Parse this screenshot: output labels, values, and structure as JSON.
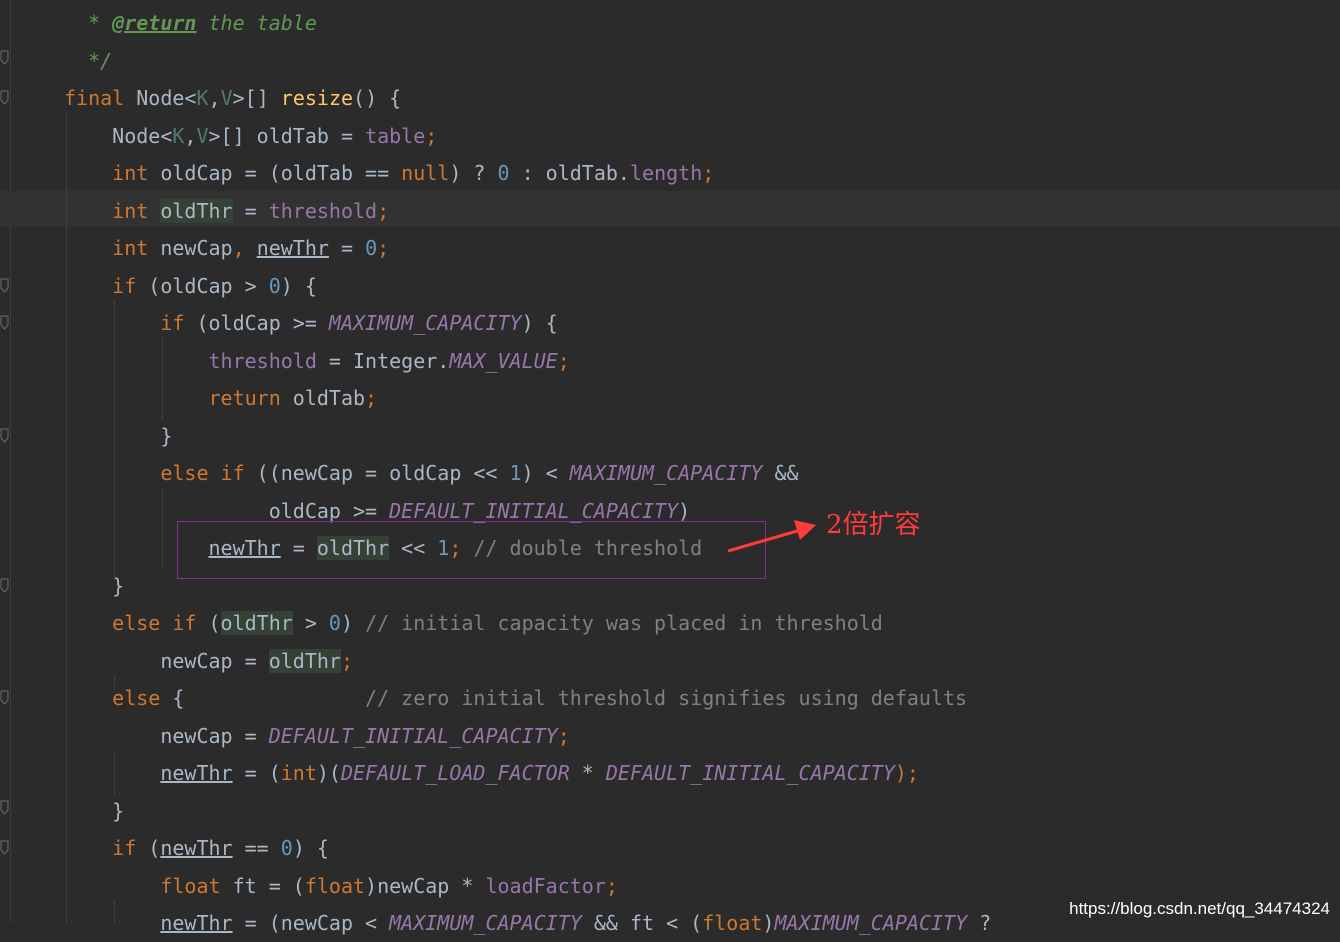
{
  "editor": {
    "lines": [
      [
        {
          "t": "  * ",
          "c": "doc"
        },
        {
          "t": "@return",
          "c": "doctag"
        },
        {
          "t": " the table",
          "c": "doc"
        }
      ],
      [
        {
          "t": "  */",
          "c": "doc"
        }
      ],
      [
        {
          "t": "final ",
          "c": "kw"
        },
        {
          "t": "Node",
          "c": ""
        },
        {
          "t": "<",
          "c": ""
        },
        {
          "t": "K",
          "c": "gen"
        },
        {
          "t": ",",
          "c": ""
        },
        {
          "t": "V",
          "c": "gen"
        },
        {
          "t": ">[] ",
          "c": ""
        },
        {
          "t": "resize",
          "c": "fn"
        },
        {
          "t": "() {",
          "c": ""
        }
      ],
      [
        {
          "t": "    Node",
          "c": ""
        },
        {
          "t": "<",
          "c": ""
        },
        {
          "t": "K",
          "c": "gen"
        },
        {
          "t": ",",
          "c": ""
        },
        {
          "t": "V",
          "c": "gen"
        },
        {
          "t": ">[] oldTab = ",
          "c": ""
        },
        {
          "t": "table",
          "c": "fld"
        },
        {
          "t": ";",
          "c": "kw"
        }
      ],
      [
        {
          "t": "    ",
          "c": ""
        },
        {
          "t": "int ",
          "c": "kw"
        },
        {
          "t": "oldCap = (oldTab == ",
          "c": ""
        },
        {
          "t": "null",
          "c": "kw"
        },
        {
          "t": ") ? ",
          "c": ""
        },
        {
          "t": "0",
          "c": "num"
        },
        {
          "t": " : oldTab.",
          "c": ""
        },
        {
          "t": "length",
          "c": "fld"
        },
        {
          "t": ";",
          "c": "kw"
        }
      ],
      [
        {
          "t": "    ",
          "c": ""
        },
        {
          "t": "int ",
          "c": "kw"
        },
        {
          "t": "oldThr",
          "c": "hl"
        },
        {
          "t": " = ",
          "c": ""
        },
        {
          "t": "threshold",
          "c": "fld"
        },
        {
          "t": ";",
          "c": "kw"
        }
      ],
      [
        {
          "t": "    ",
          "c": ""
        },
        {
          "t": "int ",
          "c": "kw"
        },
        {
          "t": "newCap",
          "c": ""
        },
        {
          "t": ", ",
          "c": "kw"
        },
        {
          "t": "newThr",
          "c": "ul"
        },
        {
          "t": " = ",
          "c": ""
        },
        {
          "t": "0",
          "c": "num"
        },
        {
          "t": ";",
          "c": "kw"
        }
      ],
      [
        {
          "t": "    ",
          "c": ""
        },
        {
          "t": "if ",
          "c": "kw"
        },
        {
          "t": "(oldCap > ",
          "c": ""
        },
        {
          "t": "0",
          "c": "num"
        },
        {
          "t": ") {",
          "c": ""
        }
      ],
      [
        {
          "t": "        ",
          "c": ""
        },
        {
          "t": "if ",
          "c": "kw"
        },
        {
          "t": "(oldCap >= ",
          "c": ""
        },
        {
          "t": "MAXIMUM_CAPACITY",
          "c": "cst"
        },
        {
          "t": ") {",
          "c": ""
        }
      ],
      [
        {
          "t": "            ",
          "c": ""
        },
        {
          "t": "threshold",
          "c": "fld"
        },
        {
          "t": " = Integer.",
          "c": ""
        },
        {
          "t": "MAX_VALUE",
          "c": "cst"
        },
        {
          "t": ";",
          "c": "kw"
        }
      ],
      [
        {
          "t": "            ",
          "c": ""
        },
        {
          "t": "return ",
          "c": "kw"
        },
        {
          "t": "oldTab",
          "c": ""
        },
        {
          "t": ";",
          "c": "kw"
        }
      ],
      [
        {
          "t": "        }",
          "c": ""
        }
      ],
      [
        {
          "t": "        ",
          "c": ""
        },
        {
          "t": "else if ",
          "c": "kw"
        },
        {
          "t": "((newCap = oldCap << ",
          "c": ""
        },
        {
          "t": "1",
          "c": "num"
        },
        {
          "t": ") < ",
          "c": ""
        },
        {
          "t": "MAXIMUM_CAPACITY",
          "c": "cst"
        },
        {
          "t": " &&",
          "c": ""
        }
      ],
      [
        {
          "t": "                 oldCap >= ",
          "c": ""
        },
        {
          "t": "DEFAULT_INITIAL_CAPACITY",
          "c": "cst"
        },
        {
          "t": ")",
          "c": ""
        }
      ],
      [
        {
          "t": "            ",
          "c": ""
        },
        {
          "t": "newThr",
          "c": "ul"
        },
        {
          "t": " = ",
          "c": ""
        },
        {
          "t": "oldThr",
          "c": "hl"
        },
        {
          "t": " << ",
          "c": ""
        },
        {
          "t": "1",
          "c": "num"
        },
        {
          "t": "; ",
          "c": "kw"
        },
        {
          "t": "// double threshold",
          "c": "cmt"
        }
      ],
      [
        {
          "t": "    }",
          "c": ""
        }
      ],
      [
        {
          "t": "    ",
          "c": ""
        },
        {
          "t": "else if ",
          "c": "kw"
        },
        {
          "t": "(",
          "c": ""
        },
        {
          "t": "oldThr",
          "c": "hl"
        },
        {
          "t": " > ",
          "c": ""
        },
        {
          "t": "0",
          "c": "num"
        },
        {
          "t": ") ",
          "c": ""
        },
        {
          "t": "// initial capacity was placed in threshold",
          "c": "cmt"
        }
      ],
      [
        {
          "t": "        newCap = ",
          "c": ""
        },
        {
          "t": "oldThr",
          "c": "hl"
        },
        {
          "t": ";",
          "c": "kw"
        }
      ],
      [
        {
          "t": "    ",
          "c": ""
        },
        {
          "t": "else ",
          "c": "kw"
        },
        {
          "t": "{               ",
          "c": ""
        },
        {
          "t": "// zero initial threshold signifies using defaults",
          "c": "cmt"
        }
      ],
      [
        {
          "t": "        newCap = ",
          "c": ""
        },
        {
          "t": "DEFAULT_INITIAL_CAPACITY",
          "c": "cst"
        },
        {
          "t": ";",
          "c": "kw"
        }
      ],
      [
        {
          "t": "        ",
          "c": ""
        },
        {
          "t": "newThr",
          "c": "ul"
        },
        {
          "t": " = (",
          "c": ""
        },
        {
          "t": "int",
          "c": "kw"
        },
        {
          "t": ")(",
          "c": ""
        },
        {
          "t": "DEFAULT_LOAD_FACTOR",
          "c": "cst"
        },
        {
          "t": " * ",
          "c": ""
        },
        {
          "t": "DEFAULT_INITIAL_CAPACITY",
          "c": "cst"
        },
        {
          "t": ");",
          "c": "kw"
        }
      ],
      [
        {
          "t": "    }",
          "c": ""
        }
      ],
      [
        {
          "t": "    ",
          "c": ""
        },
        {
          "t": "if ",
          "c": "kw"
        },
        {
          "t": "(",
          "c": ""
        },
        {
          "t": "newThr",
          "c": "ul"
        },
        {
          "t": " == ",
          "c": ""
        },
        {
          "t": "0",
          "c": "num"
        },
        {
          "t": ") {",
          "c": ""
        }
      ],
      [
        {
          "t": "        ",
          "c": ""
        },
        {
          "t": "float ",
          "c": "kw"
        },
        {
          "t": "ft = (",
          "c": ""
        },
        {
          "t": "float",
          "c": "kw"
        },
        {
          "t": ")newCap * ",
          "c": ""
        },
        {
          "t": "loadFactor",
          "c": "fld"
        },
        {
          "t": ";",
          "c": "kw"
        }
      ],
      [
        {
          "t": "        ",
          "c": ""
        },
        {
          "t": "newThr",
          "c": "ul"
        },
        {
          "t": " = (newCap < ",
          "c": ""
        },
        {
          "t": "MAXIMUM_CAPACITY",
          "c": "cst"
        },
        {
          "t": " && ft < (",
          "c": ""
        },
        {
          "t": "float",
          "c": "kw"
        },
        {
          "t": ")",
          "c": ""
        },
        {
          "t": "MAXIMUM_CAPACITY",
          "c": "cst"
        },
        {
          "t": " ?",
          "c": ""
        }
      ]
    ]
  },
  "annotation": {
    "label": "2倍扩容",
    "color": "#ff3b3b",
    "box_color": "#8a2d92"
  },
  "watermark": "https://blog.csdn.net/qq_34474324",
  "theme": {
    "background": "#2b2b2b",
    "keyword": "#cc7832",
    "field": "#9876aa",
    "number": "#6897bb",
    "method": "#ffc66d",
    "comment": "#808080",
    "doc": "#629755"
  }
}
